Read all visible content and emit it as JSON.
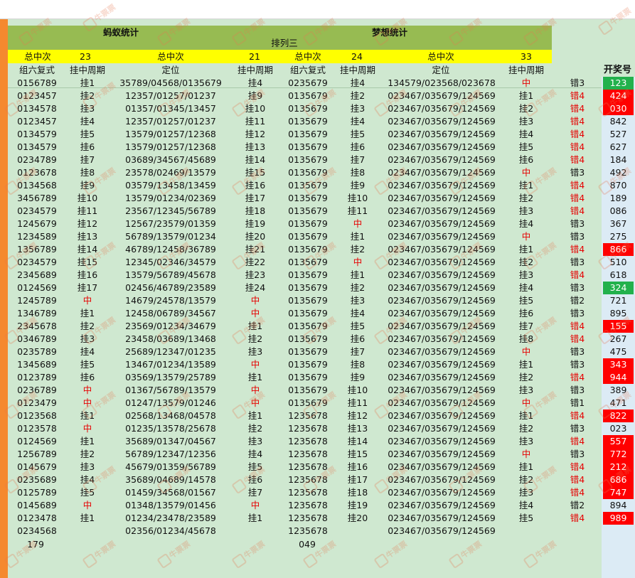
{
  "header": {
    "left_title": "蚂蚁统计",
    "right_title": "梦想统计",
    "center_title": "排列三",
    "total_label_1": "总中次",
    "total_value_1": "23",
    "total_label_2": "总中次",
    "total_value_2": "21",
    "total_label_3": "总中次",
    "total_value_3": "24",
    "total_label_4": "总中次",
    "total_value_4": "33",
    "col_zuliu_1": "组六复式",
    "col_guazhong_1": "挂中周期",
    "col_dingwei_1": "定位",
    "col_guazhong_2": "挂中周期",
    "col_zuliu_2": "组六复式",
    "col_guazhong_3": "挂中周期",
    "col_dingwei_2": "定位",
    "col_guazhong_4": "挂中周期",
    "col_kaijiang": "开奖号"
  },
  "watermark": "牛票票",
  "colors": {
    "red_bg": "#ff0000",
    "green_bg": "#22b14c",
    "header_green": "#97bb52",
    "yellow": "#ffff00",
    "sheet_bg": "#cfe8d0"
  },
  "rows": [
    [
      "0156789",
      "挂1",
      "35789/04568/0135679",
      "挂4",
      "0235679",
      "挂4",
      "134579/023568/023678",
      "中",
      "错3",
      "123",
      "green"
    ],
    [
      "0123457",
      "挂2",
      "12357/01257/01237",
      "挂9",
      "0135679",
      "挂2",
      "023467/035679/124569",
      "挂1",
      "错4",
      "424",
      "red"
    ],
    [
      "0134578",
      "挂3",
      "01357/01345/13457",
      "挂10",
      "0135679",
      "挂3",
      "023467/035679/124569",
      "挂2",
      "错4",
      "030",
      "red"
    ],
    [
      "0123457",
      "挂4",
      "12357/01257/01237",
      "挂11",
      "0135679",
      "挂4",
      "023467/035679/124569",
      "挂3",
      "错4",
      "842",
      ""
    ],
    [
      "0134579",
      "挂5",
      "13579/01257/12368",
      "挂12",
      "0135679",
      "挂5",
      "023467/035679/124569",
      "挂4",
      "错4",
      "527",
      ""
    ],
    [
      "0134579",
      "挂6",
      "13579/01257/12368",
      "挂13",
      "0135679",
      "挂6",
      "023467/035679/124569",
      "挂5",
      "错4",
      "627",
      ""
    ],
    [
      "0234789",
      "挂7",
      "03689/34567/45689",
      "挂14",
      "0135679",
      "挂7",
      "023467/035679/124569",
      "挂6",
      "错4",
      "184",
      ""
    ],
    [
      "0123678",
      "挂8",
      "23578/02469/13579",
      "挂15",
      "0135679",
      "挂8",
      "023467/035679/124569",
      "中",
      "错3",
      "492",
      ""
    ],
    [
      "0134568",
      "挂9",
      "03579/13458/13459",
      "挂16",
      "0135679",
      "挂9",
      "023467/035679/124569",
      "挂1",
      "错4",
      "870",
      ""
    ],
    [
      "3456789",
      "挂10",
      "13579/01234/02369",
      "挂17",
      "0135679",
      "挂10",
      "023467/035679/124569",
      "挂2",
      "错4",
      "189",
      ""
    ],
    [
      "0234579",
      "挂11",
      "23567/12345/56789",
      "挂18",
      "0135679",
      "挂11",
      "023467/035679/124569",
      "挂3",
      "错4",
      "086",
      ""
    ],
    [
      "1245679",
      "挂12",
      "12567/23579/01359",
      "挂19",
      "0135679",
      "中",
      "023467/035679/124569",
      "挂4",
      "错3",
      "367",
      ""
    ],
    [
      "1234589",
      "挂13",
      "56789/13579/01234",
      "挂20",
      "0135679",
      "挂1",
      "023467/035679/124569",
      "中",
      "错3",
      "275",
      ""
    ],
    [
      "1356789",
      "挂14",
      "46789/12458/36789",
      "挂21",
      "0135679",
      "挂2",
      "023467/035679/124569",
      "挂1",
      "错4",
      "866",
      "red"
    ],
    [
      "0234579",
      "挂15",
      "12345/02346/34579",
      "挂22",
      "0135679",
      "中",
      "023467/035679/124569",
      "挂2",
      "错3",
      "510",
      ""
    ],
    [
      "2345689",
      "挂16",
      "13579/56789/45678",
      "挂23",
      "0135679",
      "挂1",
      "023467/035679/124569",
      "挂3",
      "错4",
      "618",
      ""
    ],
    [
      "0124569",
      "挂17",
      "02456/46789/23589",
      "挂24",
      "0135679",
      "挂2",
      "023467/035679/124569",
      "挂4",
      "错3",
      "324",
      "green"
    ],
    [
      "1245789",
      "中",
      "14679/24578/13579",
      "中",
      "0135679",
      "挂3",
      "023467/035679/124569",
      "挂5",
      "错2",
      "721",
      ""
    ],
    [
      "1346789",
      "挂1",
      "12458/06789/34567",
      "中",
      "0135679",
      "挂4",
      "023467/035679/124569",
      "挂6",
      "错3",
      "895",
      ""
    ],
    [
      "2345678",
      "挂2",
      "23569/01234/34679",
      "挂1",
      "0135679",
      "挂5",
      "023467/035679/124569",
      "挂7",
      "错4",
      "155",
      "red"
    ],
    [
      "0346789",
      "挂3",
      "23458/03689/13468",
      "挂2",
      "0135679",
      "挂6",
      "023467/035679/124569",
      "挂8",
      "错4",
      "267",
      ""
    ],
    [
      "0235789",
      "挂4",
      "25689/12347/01235",
      "挂3",
      "0135679",
      "挂7",
      "023467/035679/124569",
      "中",
      "错3",
      "475",
      ""
    ],
    [
      "1345689",
      "挂5",
      "13467/01234/13589",
      "中",
      "0135679",
      "挂8",
      "023467/035679/124569",
      "挂1",
      "错3",
      "343",
      "red"
    ],
    [
      "0123789",
      "挂6",
      "03569/13579/25789",
      "挂1",
      "0135679",
      "挂9",
      "023467/035679/124569",
      "挂2",
      "错4",
      "944",
      "red"
    ],
    [
      "0236789",
      "中",
      "01367/56789/13579",
      "中",
      "0135679",
      "挂10",
      "023467/035679/124569",
      "挂3",
      "错3",
      "389",
      ""
    ],
    [
      "0123479",
      "中",
      "01247/13579/01246",
      "中",
      "0135679",
      "挂11",
      "023467/035679/124569",
      "中",
      "错1",
      "471",
      ""
    ],
    [
      "0123568",
      "挂1",
      "02568/13468/04578",
      "挂1",
      "1235678",
      "挂12",
      "023467/035679/124569",
      "挂1",
      "错4",
      "822",
      "red"
    ],
    [
      "0123578",
      "中",
      "01235/13578/25678",
      "挂2",
      "1235678",
      "挂13",
      "023467/035679/124569",
      "挂2",
      "错3",
      "023",
      ""
    ],
    [
      "0124569",
      "挂1",
      "35689/01347/04567",
      "挂3",
      "1235678",
      "挂14",
      "023467/035679/124569",
      "挂3",
      "错4",
      "557",
      "red"
    ],
    [
      "1256789",
      "挂2",
      "56789/12347/12356",
      "挂4",
      "1235678",
      "挂15",
      "023467/035679/124569",
      "中",
      "错3",
      "772",
      "red"
    ],
    [
      "0145679",
      "挂3",
      "45679/01359/56789",
      "挂5",
      "1235678",
      "挂16",
      "023467/035679/124569",
      "挂1",
      "错4",
      "212",
      "red"
    ],
    [
      "0235689",
      "挂4",
      "35689/04689/14578",
      "挂6",
      "1235678",
      "挂17",
      "023467/035679/124569",
      "挂2",
      "错4",
      "686",
      "red"
    ],
    [
      "0125789",
      "挂5",
      "01459/34568/01567",
      "挂7",
      "1235678",
      "挂18",
      "023467/035679/124569",
      "挂3",
      "错4",
      "747",
      "red"
    ],
    [
      "0145689",
      "中",
      "01348/13579/01456",
      "中",
      "1235678",
      "挂19",
      "023467/035679/124569",
      "挂4",
      "错2",
      "894",
      ""
    ],
    [
      "0123478",
      "挂1",
      "01234/23478/23589",
      "挂1",
      "1235678",
      "挂20",
      "023467/035679/124569",
      "挂5",
      "错4",
      "989",
      "red"
    ],
    [
      "0234568",
      "",
      "02356/01234/45678",
      "",
      "1235678",
      "",
      "023467/035679/124569",
      "",
      "",
      "",
      ""
    ]
  ],
  "footer": {
    "left_value": "179",
    "right_value": "049"
  }
}
